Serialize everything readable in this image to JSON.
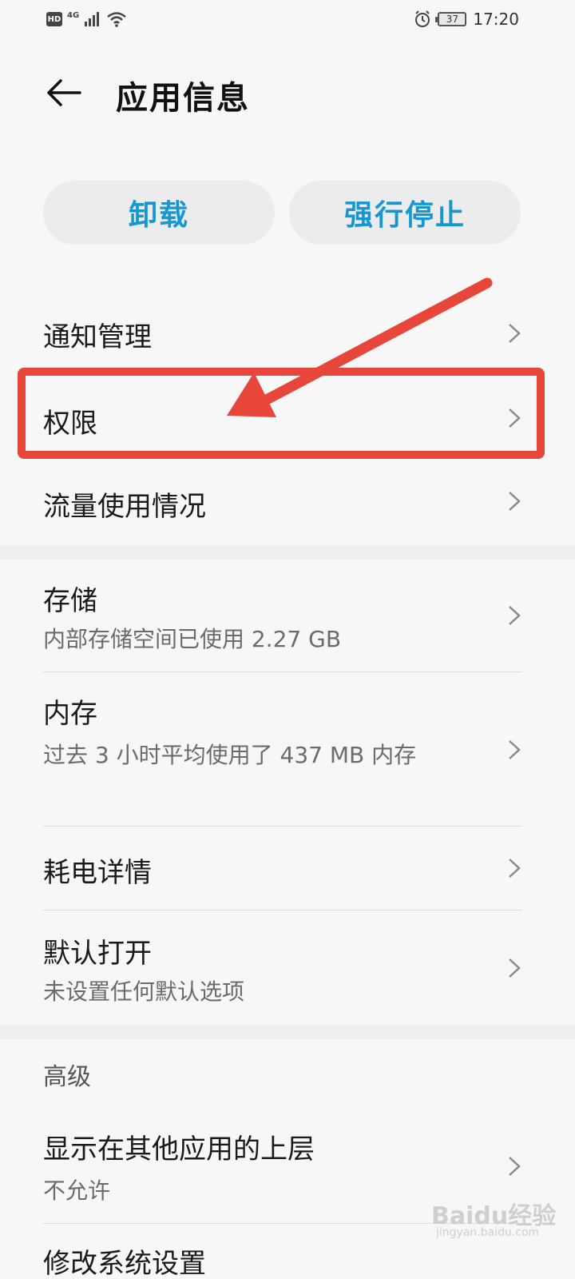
{
  "status_bar": {
    "hd_label": "HD",
    "network_label": "4G",
    "battery_level": "37",
    "time": "17:20"
  },
  "header": {
    "title": "应用信息"
  },
  "actions": {
    "uninstall_label": "卸载",
    "force_stop_label": "强行停止"
  },
  "list": {
    "notification": {
      "title": "通知管理"
    },
    "permissions": {
      "title": "权限"
    },
    "data_usage": {
      "title": "流量使用情况"
    },
    "storage": {
      "title": "存储",
      "subtitle": "内部存储空间已使用 2.27 GB"
    },
    "memory": {
      "title": "内存",
      "subtitle": "过去 3 小时平均使用了 437 MB 内存"
    },
    "battery_usage": {
      "title": "耗电详情"
    },
    "open_by_default": {
      "title": "默认打开",
      "subtitle": "未设置任何默认选项"
    },
    "advanced_header": "高级",
    "draw_over": {
      "title": "显示在其他应用的上层",
      "subtitle": "不允许"
    },
    "modify_system": {
      "title": "修改系统设置"
    }
  },
  "annotations": {
    "highlight_color": "#e8463a"
  },
  "watermark": {
    "main": "Baidu经验",
    "sub": "jingyan.baidu.com"
  }
}
